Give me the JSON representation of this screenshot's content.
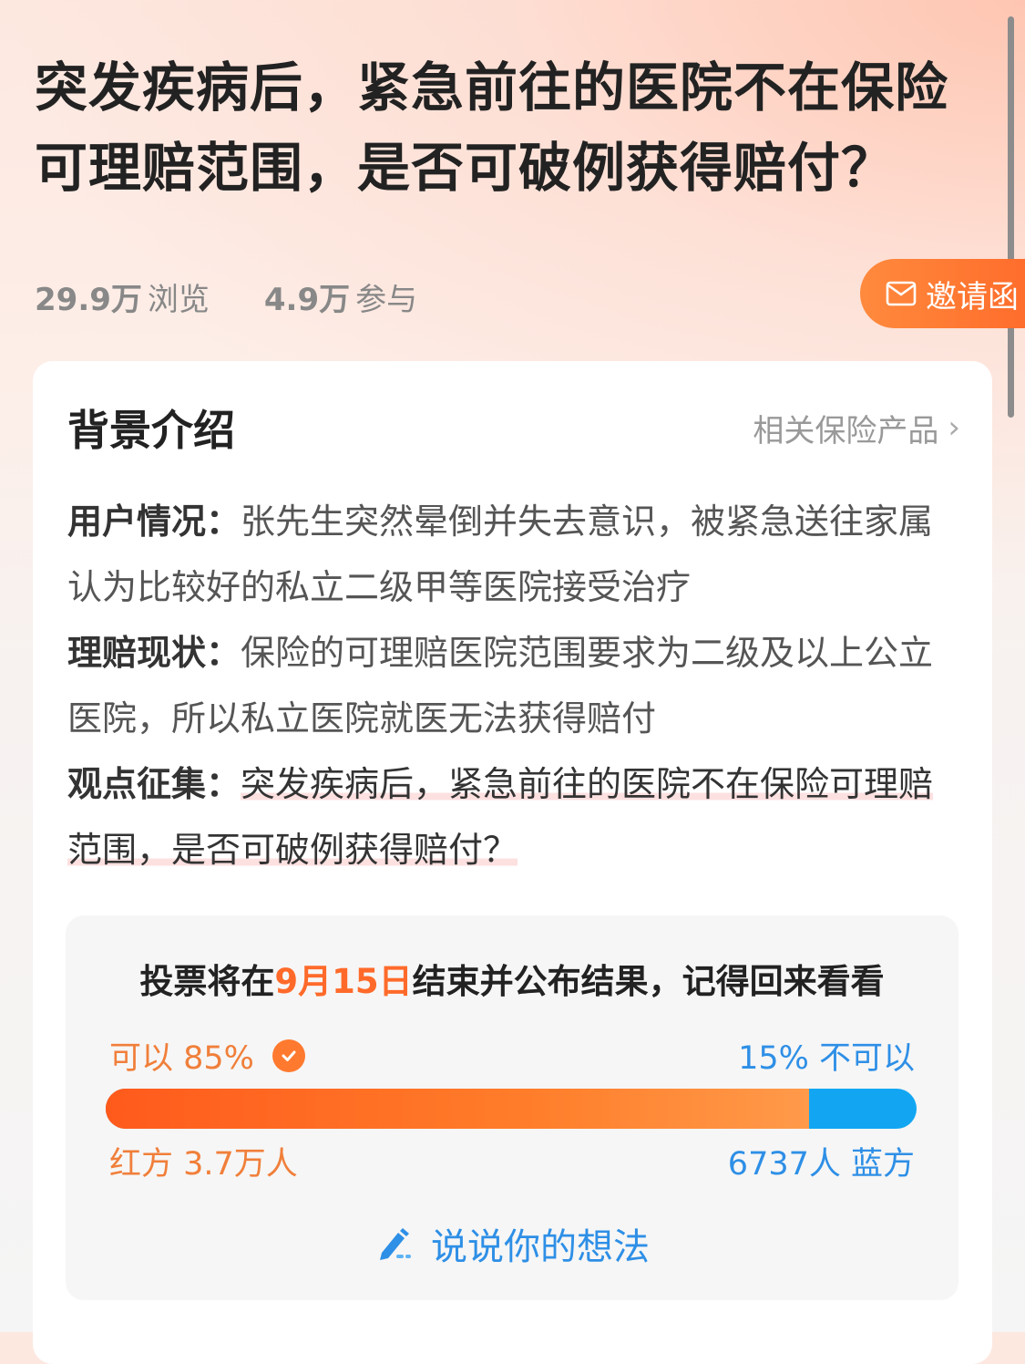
{
  "title": "突发疾病后，紧急前往的医院不在保险可理赔范围，是否可破例获得赔付？",
  "stats": {
    "views_count": "29.9万",
    "views_label": "浏览",
    "participants_count": "4.9万",
    "participants_label": "参与"
  },
  "invite_button": {
    "label": "邀请函",
    "icon": "mail-icon"
  },
  "card": {
    "title": "背景介绍",
    "related_link": "相关保险产品",
    "sections": [
      {
        "label": "用户情况：",
        "text": "张先生突然晕倒并失去意识，被紧急送往家属认为比较好的私立二级甲等医院接受治疗"
      },
      {
        "label": "理赔现状：",
        "text": "保险的可理赔医院范围要求为二级及以上公立医院，所以私立医院就医无法获得赔付"
      },
      {
        "label": "观点征集：",
        "text": "突发疾病后，紧急前往的医院不在保险可理赔范围，是否可破例获得赔付？"
      }
    ]
  },
  "vote": {
    "notice_prefix": "投票将在",
    "notice_date": "9月15日",
    "notice_suffix": "结束并公布结果，记得回来看看",
    "red_option": "可以 85%",
    "blue_option": "15% 不可以",
    "red_share": 0.85,
    "red_count": "红方 3.7万人",
    "blue_count": "6737人 蓝方",
    "comment_button": "说说你的想法"
  },
  "colors": {
    "accent_orange": "#ff6a2a",
    "vote_blue": "#12a6f2",
    "link_blue": "#2e8fe6"
  }
}
